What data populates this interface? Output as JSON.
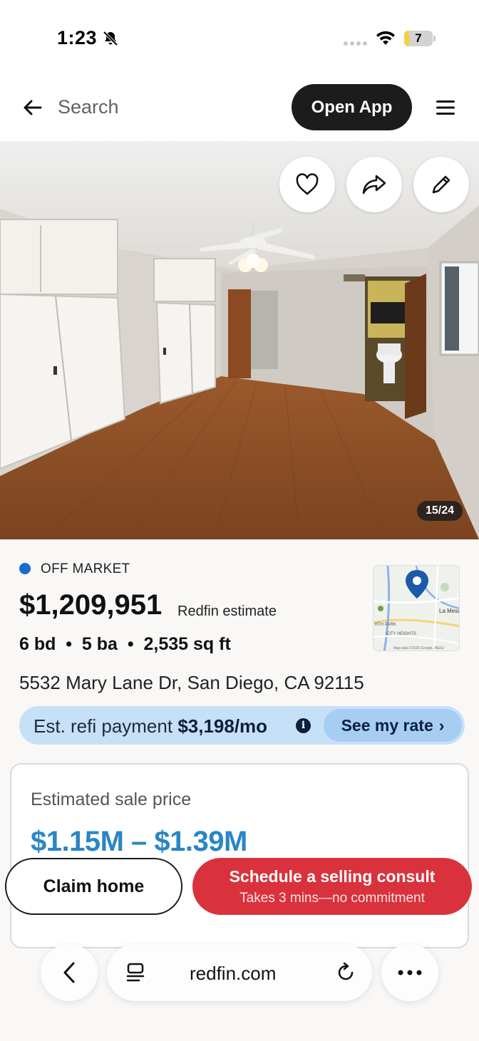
{
  "status_bar": {
    "time": "1:23",
    "battery": "7",
    "battery_level": 0.07
  },
  "nav": {
    "search_label": "Search",
    "open_app_label": "Open App"
  },
  "photo": {
    "counter": "15/24"
  },
  "listing": {
    "status": "OFF MARKET",
    "price": "$1,209,951",
    "price_label": "Redfin estimate",
    "specs": "6 bd  •  5 ba  •  2,535 sq ft",
    "address": "5532 Mary Lane Dr, San Diego, CA 92115"
  },
  "map": {
    "label_city": "La Mesa",
    "label_area1": "RTH PARK",
    "label_area2": "CITY HEIGHTS",
    "attribution": "Map data ©2026 Google, INEGI"
  },
  "refi": {
    "prefix": "Est. refi payment ",
    "amount": "$3,198/mo",
    "info": "i",
    "button": "See my rate",
    "chevron": "›"
  },
  "estimate": {
    "label": "Estimated sale price",
    "range": "$1.15M – $1.39M"
  },
  "actions": {
    "claim": "Claim home",
    "consult_title": "Schedule a selling consult",
    "consult_subtitle": "Takes 3 mins—no commitment"
  },
  "browser": {
    "url": "redfin.com"
  },
  "colors": {
    "accent_red": "#d9323d",
    "refi_blue": "#c6e0f7",
    "estimate_blue": "#2a86c4",
    "status_blue": "#1a6ad1"
  }
}
